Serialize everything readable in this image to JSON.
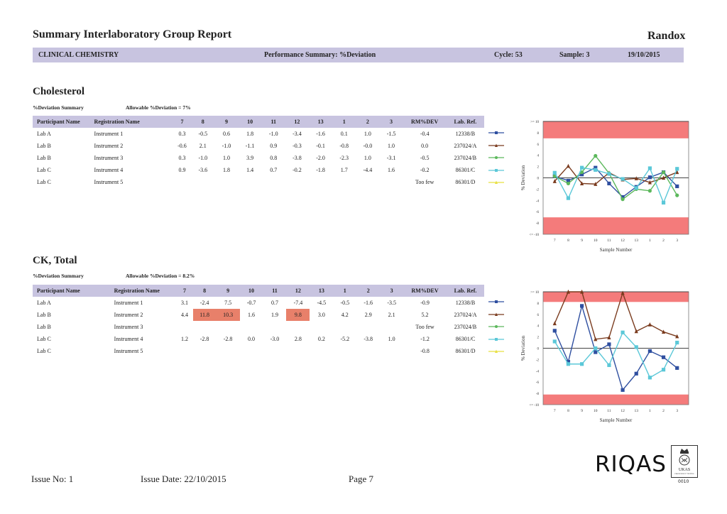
{
  "header": {
    "title": "Summary Interlaboratory Group Report",
    "brand": "Randox",
    "band": {
      "program": "CLINICAL CHEMISTRY",
      "summary": "Performance Summary: %Deviation",
      "cycle": "Cycle: 53",
      "sample": "Sample: 3",
      "date": "19/10/2015"
    }
  },
  "columns": {
    "participant": "Participant Name",
    "registration": "Registration Name",
    "samples": [
      "7",
      "8",
      "9",
      "10",
      "11",
      "12",
      "13",
      "1",
      "2",
      "3"
    ],
    "rm": "RM%DEV",
    "labref": "Lab. Ref."
  },
  "series_colors": [
    "#2f4fa0",
    "#7a3b1e",
    "#5cb85c",
    "#5bc8d8",
    "#e8e040"
  ],
  "series_markers": [
    "square",
    "triangle",
    "circle",
    "square",
    "triangle"
  ],
  "sections": [
    {
      "title": "Cholesterol",
      "summary_label": "%Deviation Summary",
      "allowable": "Allowable %Deviation = 7%",
      "rows": [
        {
          "participant": "Lab A",
          "registration": "Instrument 1",
          "values": [
            "0.3",
            "-0.5",
            "0.6",
            "1.8",
            "-1.0",
            "-3.4",
            "-1.6",
            "0.1",
            "1.0",
            "-1.5"
          ],
          "rm": "-0.4",
          "labref": "12338/B",
          "flagged": []
        },
        {
          "participant": "Lab B",
          "registration": "Instrument 2",
          "values": [
            "-0.6",
            "2.1",
            "-1.0",
            "-1.1",
            "0.9",
            "-0.3",
            "-0.1",
            "-0.8",
            "-0.0",
            "1.0"
          ],
          "rm": "0.0",
          "labref": "237024/A",
          "flagged": []
        },
        {
          "participant": "Lab B",
          "registration": "Instrument 3",
          "values": [
            "0.3",
            "-1.0",
            "1.0",
            "3.9",
            "0.8",
            "-3.8",
            "-2.0",
            "-2.3",
            "1.0",
            "-3.1"
          ],
          "rm": "-0.5",
          "labref": "237024/B",
          "flagged": []
        },
        {
          "participant": "Lab C",
          "registration": "Instrument 4",
          "values": [
            "0.9",
            "-3.6",
            "1.8",
            "1.4",
            "0.7",
            "-0.2",
            "-1.8",
            "1.7",
            "-4.4",
            "1.6"
          ],
          "rm": "-0.2",
          "labref": "86301/C",
          "flagged": []
        },
        {
          "participant": "Lab C",
          "registration": "Instrument 5",
          "values": [
            "",
            "",
            "",
            "",
            "",
            "",
            "",
            "",
            "",
            ""
          ],
          "rm": "Too few",
          "labref": "86301/D",
          "flagged": []
        }
      ]
    },
    {
      "title": "CK, Total",
      "summary_label": "%Deviation Summary",
      "allowable": "Allowable %Deviation = 8.2%",
      "rows": [
        {
          "participant": "Lab A",
          "registration": "Instrument 1",
          "values": [
            "3.1",
            "-2.4",
            "7.5",
            "-0.7",
            "0.7",
            "-7.4",
            "-4.5",
            "-0.5",
            "-1.6",
            "-3.5"
          ],
          "rm": "-0.9",
          "labref": "12338/B",
          "flagged": []
        },
        {
          "participant": "Lab B",
          "registration": "Instrument 2",
          "values": [
            "4.4",
            "11.8",
            "10.3",
            "1.6",
            "1.9",
            "9.8",
            "3.0",
            "4.2",
            "2.9",
            "2.1"
          ],
          "rm": "5.2",
          "labref": "237024/A",
          "flagged": [
            1,
            2,
            5
          ]
        },
        {
          "participant": "Lab B",
          "registration": "Instrument 3",
          "values": [
            "",
            "",
            "",
            "",
            "",
            "",
            "",
            "",
            "",
            ""
          ],
          "rm": "Too few",
          "labref": "237024/B",
          "flagged": []
        },
        {
          "participant": "Lab C",
          "registration": "Instrument 4",
          "values": [
            "1.2",
            "-2.8",
            "-2.8",
            "0.0",
            "-3.0",
            "2.8",
            "0.2",
            "-5.2",
            "-3.8",
            "1.0"
          ],
          "rm": "-1.2",
          "labref": "86301/C",
          "flagged": []
        },
        {
          "participant": "Lab C",
          "registration": "Instrument 5",
          "values": [
            "",
            "",
            "",
            "",
            "",
            "",
            "",
            "",
            "",
            ""
          ],
          "rm": "-0.8",
          "labref": "86301/D",
          "flagged": []
        }
      ]
    }
  ],
  "chart_data": [
    {
      "type": "line",
      "title": "Cholesterol",
      "xlabel": "Sample Number",
      "ylabel": "% Deviation",
      "categories": [
        "7",
        "8",
        "9",
        "10",
        "11",
        "12",
        "13",
        "1",
        "2",
        "3"
      ],
      "ylim": [
        -10,
        10
      ],
      "yticks": [
        ">= 10",
        "8",
        "6",
        "4",
        "2",
        "0",
        "-2",
        "-4",
        "-6",
        "-8",
        "<= -10"
      ],
      "allowable_limit": 7,
      "out_of_range_band_color": "#f47b7b",
      "series": [
        {
          "name": "12338/B",
          "values": [
            0.3,
            -0.5,
            0.6,
            1.8,
            -1.0,
            -3.4,
            -1.6,
            0.1,
            1.0,
            -1.5
          ]
        },
        {
          "name": "237024/A",
          "values": [
            -0.6,
            2.1,
            -1.0,
            -1.1,
            0.9,
            -0.3,
            -0.1,
            -0.8,
            -0.0,
            1.0
          ]
        },
        {
          "name": "237024/B",
          "values": [
            0.3,
            -1.0,
            1.0,
            3.9,
            0.8,
            -3.8,
            -2.0,
            -2.3,
            1.0,
            -3.1
          ]
        },
        {
          "name": "86301/C",
          "values": [
            0.9,
            -3.6,
            1.8,
            1.4,
            0.7,
            -0.2,
            -1.8,
            1.7,
            -4.4,
            1.6
          ]
        },
        {
          "name": "86301/D",
          "values": []
        }
      ]
    },
    {
      "type": "line",
      "title": "CK, Total",
      "xlabel": "Sample Number",
      "ylabel": "% Deviation",
      "categories": [
        "7",
        "8",
        "9",
        "10",
        "11",
        "12",
        "13",
        "1",
        "2",
        "3"
      ],
      "ylim": [
        -10,
        10
      ],
      "yticks": [
        ">= 10",
        "8",
        "6",
        "4",
        "2",
        "0",
        "-2",
        "-4",
        "-6",
        "-8",
        "<= -10"
      ],
      "allowable_limit": 8.2,
      "out_of_range_band_color": "#f47b7b",
      "series": [
        {
          "name": "12338/B",
          "values": [
            3.1,
            -2.4,
            7.5,
            -0.7,
            0.7,
            -7.4,
            -4.5,
            -0.5,
            -1.6,
            -3.5
          ]
        },
        {
          "name": "237024/A",
          "values": [
            4.4,
            11.8,
            10.3,
            1.6,
            1.9,
            9.8,
            3.0,
            4.2,
            2.9,
            2.1
          ]
        },
        {
          "name": "237024/B",
          "values": []
        },
        {
          "name": "86301/C",
          "values": [
            1.2,
            -2.8,
            -2.8,
            0.0,
            -3.0,
            2.8,
            0.2,
            -5.2,
            -3.8,
            1.0
          ]
        },
        {
          "name": "86301/D",
          "values": []
        }
      ]
    }
  ],
  "footer": {
    "issue_no": "Issue No: 1",
    "issue_date": "Issue Date: 22/10/2015",
    "page": "Page 7",
    "logo": "RIQAS",
    "accreditation": "UKAS",
    "accreditation_sub": "PROFICIENCY TESTING",
    "accreditation_no": "0010"
  }
}
